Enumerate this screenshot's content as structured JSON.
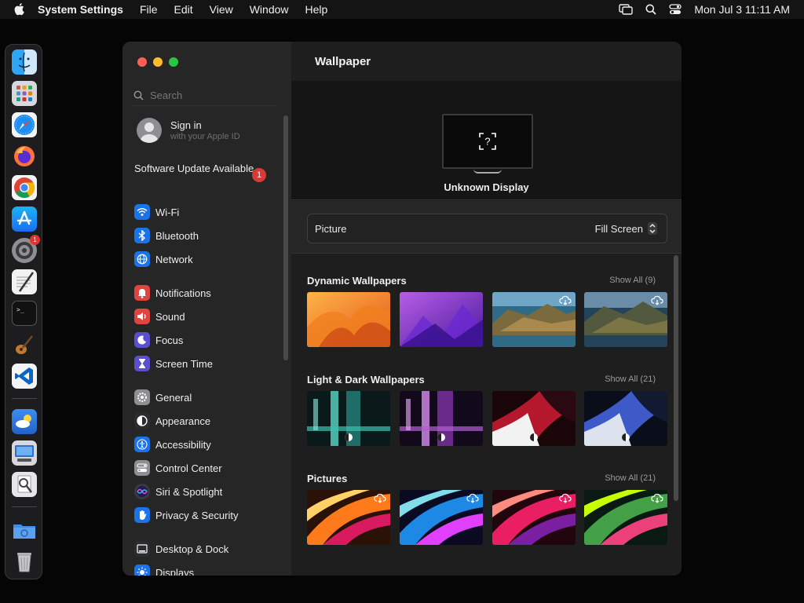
{
  "menubar": {
    "app_name": "System Settings",
    "menus": [
      "File",
      "Edit",
      "View",
      "Window",
      "Help"
    ],
    "datetime": "Mon Jul 3  11:11 AM"
  },
  "dock": {
    "settings_badge": "1"
  },
  "sidebar": {
    "search_placeholder": "Search",
    "signin": {
      "title": "Sign in",
      "subtitle": "with your Apple ID"
    },
    "software_update": {
      "label": "Software Update Available",
      "badge": "1"
    },
    "items": [
      {
        "label": "Wi-Fi",
        "icon": "wifi-icon",
        "color": "#1a73e8"
      },
      {
        "label": "Bluetooth",
        "icon": "bluetooth-icon",
        "color": "#1a73e8"
      },
      {
        "label": "Network",
        "icon": "globe-icon",
        "color": "#1a73e8"
      },
      {
        "label": "Notifications",
        "icon": "bell-icon",
        "color": "#e0443e"
      },
      {
        "label": "Sound",
        "icon": "speaker-icon",
        "color": "#e0443e"
      },
      {
        "label": "Focus",
        "icon": "moon-icon",
        "color": "#5a4fcf"
      },
      {
        "label": "Screen Time",
        "icon": "hourglass-icon",
        "color": "#5a4fcf"
      },
      {
        "label": "General",
        "icon": "gear-icon",
        "color": "#8e8e93"
      },
      {
        "label": "Appearance",
        "icon": "appearance-icon",
        "color": "#2c2c2e"
      },
      {
        "label": "Accessibility",
        "icon": "accessibility-icon",
        "color": "#1a73e8"
      },
      {
        "label": "Control Center",
        "icon": "control-center-icon",
        "color": "#8e8e93"
      },
      {
        "label": "Siri & Spotlight",
        "icon": "siri-icon",
        "color": "#3a3a3c"
      },
      {
        "label": "Privacy & Security",
        "icon": "hand-icon",
        "color": "#1a73e8"
      },
      {
        "label": "Desktop & Dock",
        "icon": "desktop-icon",
        "color": "#2c2c2e"
      },
      {
        "label": "Displays",
        "icon": "sun-icon",
        "color": "#1a73e8"
      }
    ]
  },
  "main": {
    "title": "Wallpaper",
    "display_name": "Unknown Display",
    "picture_label": "Picture",
    "fill_option": "Fill Screen",
    "sections": [
      {
        "title": "Dynamic Wallpapers",
        "show_all": "Show All (9)"
      },
      {
        "title": "Light & Dark Wallpapers",
        "show_all": "Show All (21)"
      },
      {
        "title": "Pictures",
        "show_all": "Show All (21)"
      }
    ]
  }
}
